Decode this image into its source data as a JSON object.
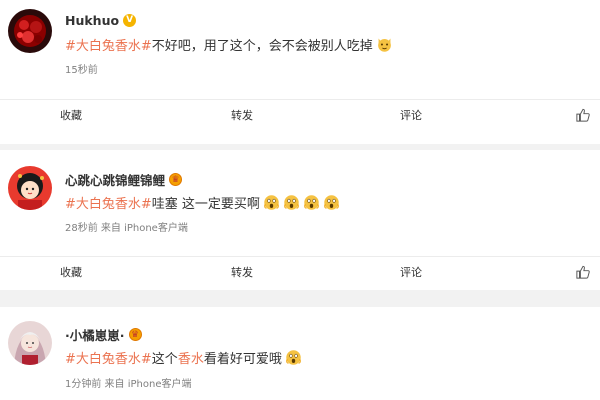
{
  "posts": [
    {
      "username": "Hukhuo",
      "badge": "V",
      "tag": "#大白兔香水#",
      "text": "不好吧，用了这个，会不会被别人吃掉",
      "emojis": [
        "cat-face-emoji"
      ],
      "meta": "15秒前",
      "actions": {
        "favorite": "收藏",
        "repost": "转发",
        "comment": "评论"
      }
    },
    {
      "username": "心跳心跳锦鲤锦鲤",
      "badge": "♛",
      "tag": "#大白兔香水#",
      "text": " 哇塞 这一定要买啊",
      "emojis": [
        "scream-emoji",
        "scream-emoji",
        "scream-emoji",
        "scream-emoji"
      ],
      "meta": "28秒前 来自 iPhone客户端",
      "actions": {
        "favorite": "收藏",
        "repost": "转发",
        "comment": "评论"
      }
    },
    {
      "username": "·小橘崽崽·",
      "badge": "♛",
      "tag": "#大白兔香水#",
      "text_before": "这个",
      "link": "香水",
      "text_after": "看着好可爱哦",
      "emojis": [
        "scream-emoji"
      ],
      "meta": "1分钟前 来自 iPhone客户端"
    }
  ],
  "colors": {
    "accent": "#eb7350",
    "badge_gold": "#f5b400",
    "meta_gray": "#808080",
    "background": "#f2f2f2"
  }
}
